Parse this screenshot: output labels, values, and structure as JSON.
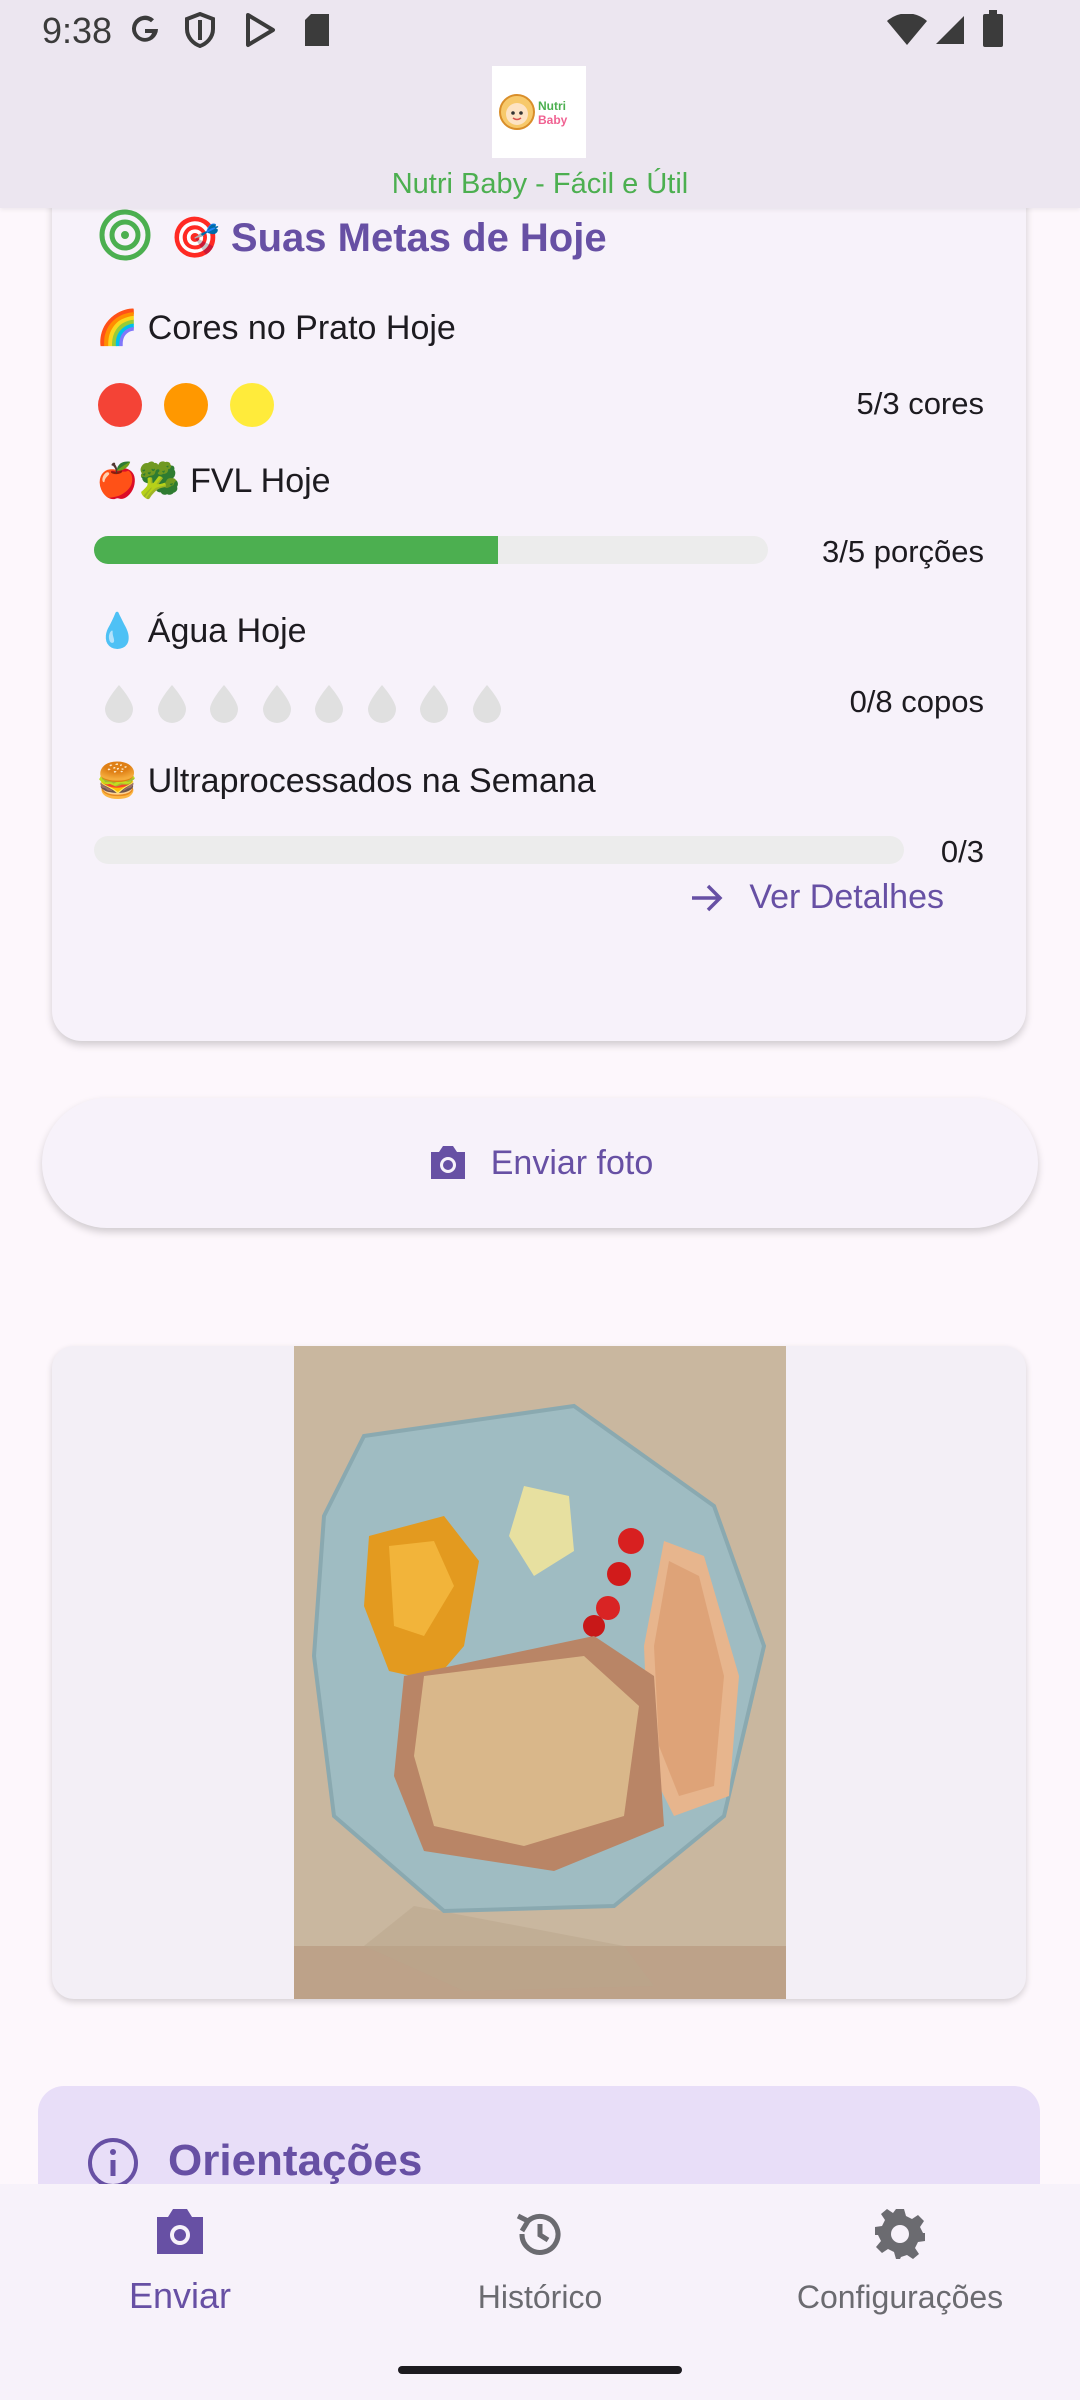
{
  "status_bar": {
    "time": "9:38",
    "left_icons": [
      "google-icon",
      "shield-icon",
      "play-store-icon",
      "sd-card-icon"
    ],
    "right_icons": [
      "wifi-icon",
      "signal-icon",
      "battery-icon"
    ]
  },
  "header": {
    "logo_text_line1": "Nutri",
    "logo_text_line2": "Baby",
    "subtitle": "Nutri Baby - Fácil e Útil"
  },
  "goals": {
    "title": "🎯 Suas Metas de Hoje",
    "colors": {
      "label": "🌈 Cores no Prato Hoje",
      "value": "5/3 cores",
      "dots": [
        "#f44336",
        "#ff9800",
        "#ffeb3b"
      ]
    },
    "fvl": {
      "label": "🍎🥦 FVL Hoje",
      "value": "3/5 porções",
      "progress": 0.6
    },
    "water": {
      "label": "💧 Água Hoje",
      "value": "0/8 copos",
      "filled": 0,
      "total": 8
    },
    "ultra": {
      "label": "🍔 Ultraprocessados na Semana",
      "value": "0/3",
      "progress": 0
    },
    "details_link": "Ver Detalhes"
  },
  "photo_button": {
    "label": "Enviar foto"
  },
  "orientation": {
    "title": "Orientações"
  },
  "bottom_nav": {
    "items": [
      {
        "label": "Enviar",
        "icon": "camera-icon",
        "active": true
      },
      {
        "label": "Histórico",
        "icon": "history-icon",
        "active": false
      },
      {
        "label": "Configurações",
        "icon": "gear-icon",
        "active": false
      }
    ]
  },
  "colors": {
    "accent": "#6750a4",
    "green": "#4caf50",
    "header_bg": "#ece6f0"
  }
}
